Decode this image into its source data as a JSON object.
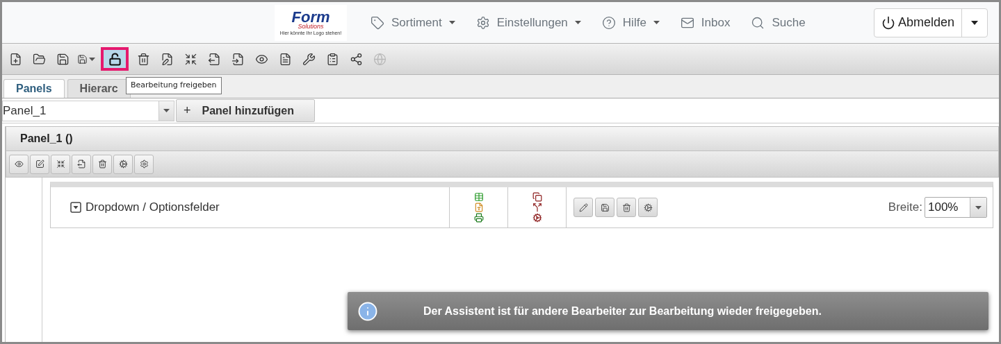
{
  "logo": {
    "brand": "Form",
    "brand_sub": "Solutions",
    "tagline": "Hier könnte Ihr Logo stehen!"
  },
  "nav": [
    {
      "label": "Sortiment",
      "dropdown": true
    },
    {
      "label": "Einstellungen",
      "dropdown": true
    },
    {
      "label": "Hilfe",
      "dropdown": true
    },
    {
      "label": "Inbox",
      "dropdown": false
    },
    {
      "label": "Suche",
      "dropdown": false
    }
  ],
  "logout": {
    "label": "Abmelden"
  },
  "toolbar": [
    {
      "highlighted": false,
      "disabled": false
    },
    {
      "highlighted": false,
      "disabled": false
    },
    {
      "highlighted": false,
      "disabled": false
    },
    {
      "highlighted": false,
      "disabled": false
    },
    {
      "highlighted": true,
      "disabled": false
    },
    {
      "highlighted": false,
      "disabled": false
    },
    {
      "highlighted": false,
      "disabled": false
    },
    {
      "highlighted": false,
      "disabled": false
    },
    {
      "highlighted": false,
      "disabled": false
    },
    {
      "highlighted": false,
      "disabled": false
    },
    {
      "highlighted": false,
      "disabled": false
    },
    {
      "highlighted": false,
      "disabled": false
    },
    {
      "highlighted": false,
      "disabled": false
    },
    {
      "highlighted": false,
      "disabled": false
    },
    {
      "highlighted": false,
      "disabled": false
    },
    {
      "highlighted": false,
      "disabled": true
    }
  ],
  "tooltip": "Bearbeitung freigeben",
  "tabs": [
    {
      "label": "Panels",
      "selected": true
    },
    {
      "label": "Hierarc",
      "selected": false
    }
  ],
  "panel_select": {
    "value": "Panel_1"
  },
  "add_panel_button": {
    "icon": "+",
    "label": "Panel hinzufügen"
  },
  "panel": {
    "title": "Panel_1 ()",
    "rows": [
      {
        "label": "Dropdown / Optionsfelder",
        "width_label": "Breite:",
        "width_value": "100%"
      }
    ]
  },
  "notification": {
    "message": "Der Assistent ist für andere Bearbeiter zur Bearbeitung wieder freigegeben."
  }
}
